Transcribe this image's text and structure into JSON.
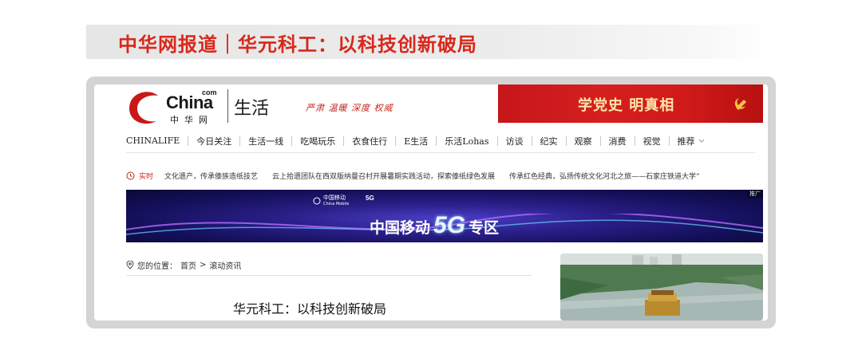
{
  "headline": "中华网报道｜华元科工：以科技创新破局",
  "site": {
    "logo_text": "China",
    "logo_com": "com",
    "logo_cn": "中华网",
    "channel": "生活",
    "slogan": "严肃  温暖  深度  权威"
  },
  "banner_party": {
    "text": "学党史 明真相"
  },
  "nav": {
    "items": [
      "CHINALIFE",
      "今日关注",
      "生活一线",
      "吃喝玩乐",
      "衣食住行",
      "E生活",
      "乐活Lohas",
      "访谈",
      "纪实",
      "观察",
      "消费",
      "视觉"
    ],
    "more_label": "推荐"
  },
  "ticker": {
    "label": "实时",
    "items": [
      "文化遗产，传承傣族造纸技艺",
      "云上拾遗团队在西双版纳曼召村开展暑期实践活动，探索傣纸绿色发展",
      "传承红色经典，弘扬传统文化河北之旅——石家庄铁道大学“"
    ]
  },
  "banner_5g": {
    "brand": "中国移动",
    "brand_en": "China Mobile",
    "badge": "5G",
    "main_pre": "中国移动",
    "main_5g": "5G",
    "main_post": "专区",
    "ad_label": "推广"
  },
  "breadcrumb": {
    "prefix": "您的位置：",
    "home": "首页",
    "sep": ">",
    "current": "滚动资讯"
  },
  "article": {
    "title": "华元科工：以科技创新破局"
  },
  "colors": {
    "accent_red": "#d8281c",
    "nav_text": "#222222"
  }
}
